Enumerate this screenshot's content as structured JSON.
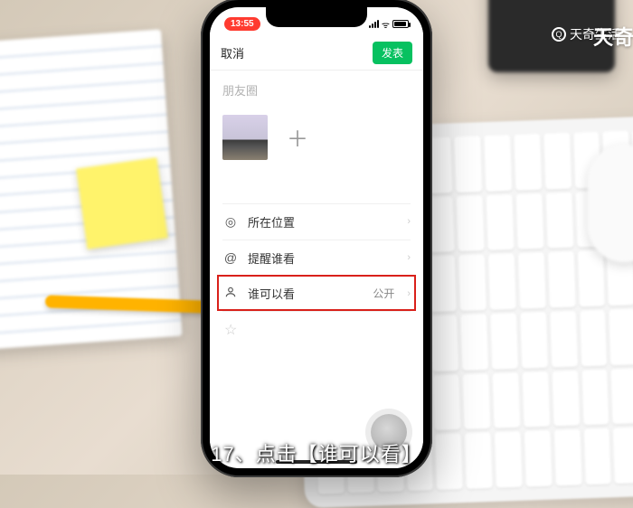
{
  "watermark": {
    "brand": "天奇生活",
    "side": "天奇"
  },
  "caption": "17、点击【谁可以看】",
  "statusbar": {
    "time": "13:55"
  },
  "navbar": {
    "cancel": "取消",
    "post": "发表"
  },
  "compose": {
    "placeholder": "朋友圈"
  },
  "options": {
    "location": {
      "label": "所在位置"
    },
    "mention": {
      "label": "提醒谁看"
    },
    "visibility": {
      "label": "谁可以看",
      "value": "公开"
    }
  },
  "icons": {
    "location": "◎",
    "mention": "@",
    "visibility": "👤",
    "star": "☆",
    "plus": "＋",
    "chevron": "›",
    "wifi": "▾"
  },
  "colors": {
    "accent": "#07c160",
    "highlight": "#d9201a",
    "time_badge": "#ff3b30"
  }
}
